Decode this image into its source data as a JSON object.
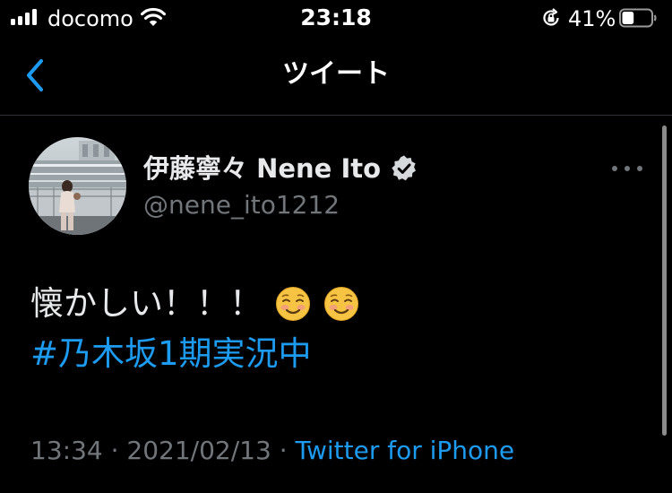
{
  "status_bar": {
    "carrier": "docomo",
    "time": "23:18",
    "battery_percent": "41%",
    "battery_level": 0.41,
    "signal_icon": "cellular-signal-icon",
    "wifi_icon": "wifi-icon",
    "rotation_lock_icon": "rotation-lock-icon",
    "battery_icon": "battery-icon"
  },
  "nav": {
    "title": "ツイート",
    "back_icon": "chevron-left-icon"
  },
  "tweet": {
    "display_name": "伊藤寧々 Nene Ito",
    "handle": "@nene_ito1212",
    "verified_icon": "verified-badge-icon",
    "more_icon": "more-horizontal-icon",
    "text_line1": "懐かしい！！！",
    "emojis": [
      "smiling-face-icon",
      "smiling-face-icon"
    ],
    "hashtag": "#乃木坂1期実況中",
    "time": "13:34",
    "separator": " · ",
    "date": "2021/02/13",
    "source": "Twitter for iPhone"
  },
  "colors": {
    "background": "#000000",
    "primary_text": "#e7e9ea",
    "secondary_text": "#71767b",
    "accent": "#1d9bf0",
    "divider": "#2f3336"
  }
}
